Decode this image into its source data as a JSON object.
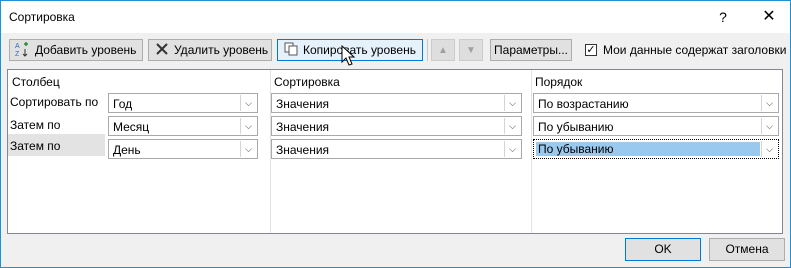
{
  "window": {
    "title": "Сортировка",
    "help_glyph": "?",
    "close_glyph": "✕"
  },
  "toolbar": {
    "add_level": "Добавить уровень",
    "delete_level": "Удалить уровень",
    "copy_level": "Копировать уровень",
    "move_up_glyph": "▲",
    "move_down_glyph": "▼",
    "options": "Параметры...",
    "has_headers_label": "Мои данные содержат заголовки",
    "has_headers_checked": true
  },
  "grid": {
    "headers": {
      "column": "Столбец",
      "sort_on": "Сортировка",
      "order": "Порядок"
    },
    "rows": [
      {
        "label": "Сортировать по",
        "column": "Год",
        "sort_on": "Значения",
        "order": "По возрастанию"
      },
      {
        "label": "Затем по",
        "column": "Месяц",
        "sort_on": "Значения",
        "order": "По убыванию"
      },
      {
        "label": "Затем по",
        "column": "День",
        "sort_on": "Значения",
        "order": "По убыванию"
      }
    ],
    "selected_row": 2
  },
  "footer": {
    "ok": "OK",
    "cancel": "Отмена"
  },
  "colors": {
    "accent": "#0078d7",
    "selection": "#99c9ef",
    "border": "#1e90d6"
  }
}
